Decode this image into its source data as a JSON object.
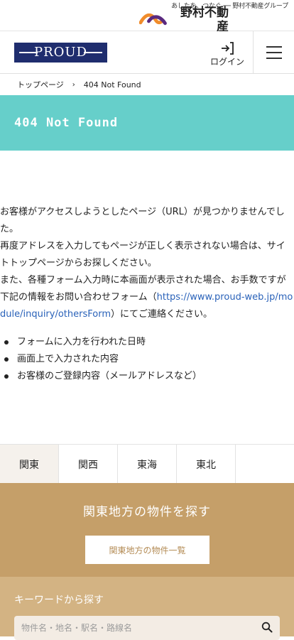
{
  "brand": {
    "tagline": "あしたを、つなぐ ── 野村不動産グループ",
    "name": "野村不動産"
  },
  "header": {
    "logo_text": "PROUD",
    "login_label": "ログイン"
  },
  "breadcrumb": {
    "home": "トップページ",
    "separator": "›",
    "current": "404 Not Found"
  },
  "page": {
    "title": "404 Not Found"
  },
  "message": {
    "p1": "お客様がアクセスしようとしたページ（URL）が見つかりませんでした。",
    "p2": "再度アドレスを入力してもページが正しく表示されない場合は、サイトトップページからお探しください。",
    "p3_before": "また、各種フォーム入力時に本画面が表示された場合、お手数ですが下記の情報をお問い合わせフォーム（",
    "p3_link": "https://www.proud-web.jp/module/inquiry/othersForm",
    "p3_after": "）にてご連絡ください。",
    "bullets": [
      "フォームに入力を行われた日時",
      "画面上で入力された内容",
      "お客様のご登録内容（メールアドレスなど）"
    ]
  },
  "regions": {
    "tabs": [
      "関東",
      "関西",
      "東海",
      "東北"
    ],
    "active_index": 0,
    "panel_title": "関東地方の物件を探す",
    "list_button": "関東地方の物件一覧"
  },
  "search": {
    "label": "キーワードから探す",
    "placeholder": "物件名・地名・駅名・路線名"
  },
  "colors": {
    "accent_teal": "#66cfca",
    "brand_navy": "#1f2d6e",
    "panel_gold": "#c59f69",
    "link_blue": "#2a62b9"
  }
}
